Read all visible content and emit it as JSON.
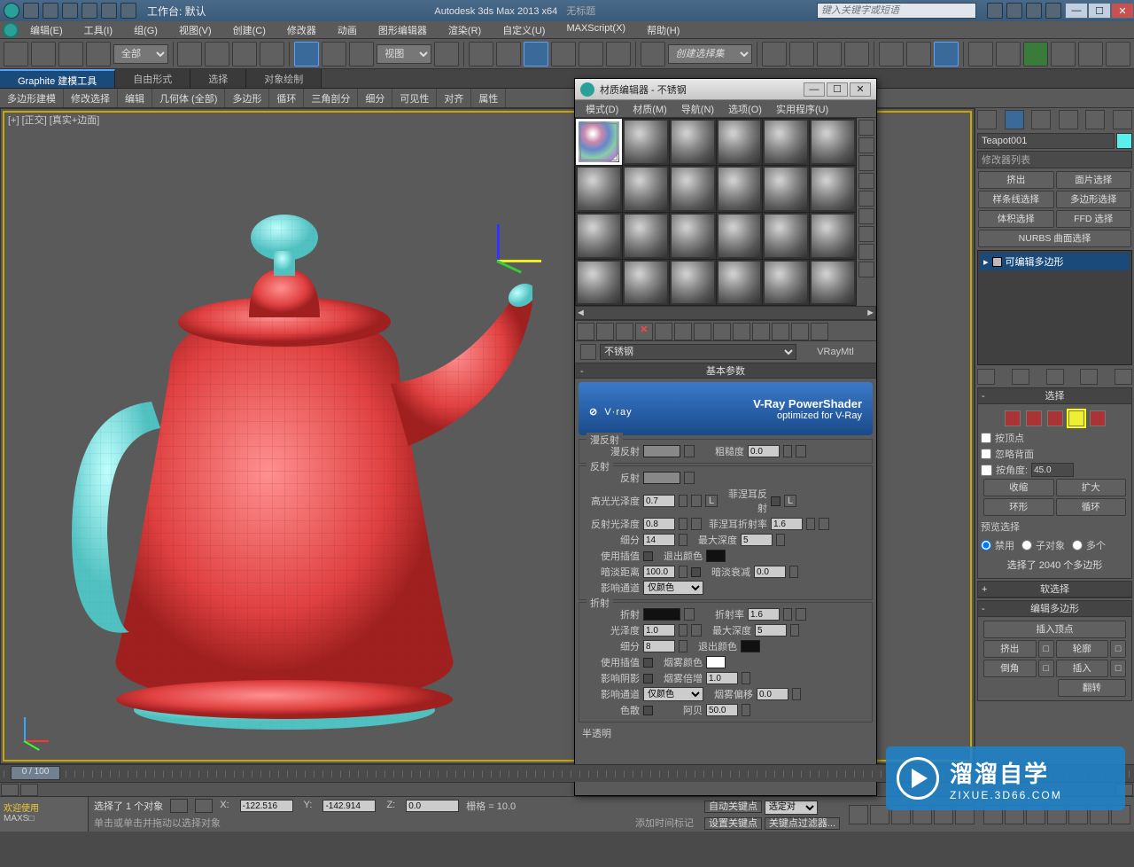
{
  "titlebar": {
    "workspace": "工作台: 默认",
    "app": "Autodesk 3ds Max  2013 x64",
    "untitled": "无标题",
    "search_ph": "键入关键字或短语"
  },
  "menubar": [
    "编辑(E)",
    "工具(I)",
    "组(G)",
    "视图(V)",
    "创建(C)",
    "修改器",
    "动画",
    "图形编辑器",
    "渲染(R)",
    "自定义(U)",
    "MAXScript(X)",
    "帮助(H)"
  ],
  "toolbar": {
    "sel_filter": "全部",
    "refcoord": "视图",
    "named_sel": "创建选择集"
  },
  "ribbon": {
    "tabs": [
      "Graphite 建模工具",
      "自由形式",
      "选择",
      "对象绘制"
    ],
    "bar": [
      "多边形建模",
      "修改选择",
      "编辑",
      "几何体 (全部)",
      "多边形",
      "循环",
      "三角剖分",
      "细分",
      "可见性",
      "对齐",
      "属性"
    ]
  },
  "viewport": {
    "label": "[+] [正交] [真实+边面]"
  },
  "rpanel": {
    "obj": "Teapot001",
    "modlist": "修改器列表",
    "btns1": [
      "挤出",
      "面片选择"
    ],
    "btns2": [
      "样条线选择",
      "多边形选择"
    ],
    "btns3": [
      "体积选择",
      "FFD 选择"
    ],
    "btns4": [
      "NURBS 曲面选择"
    ],
    "stack_item": "可编辑多边形",
    "sel_hd": "选择",
    "byvert": "按顶点",
    "ignback": "忽略背面",
    "byangle": "按角度:",
    "angle": "45.0",
    "shrink": "收缩",
    "grow": "扩大",
    "ring": "环形",
    "loop": "循环",
    "preview": "预览选择",
    "off": "禁用",
    "subobj": "子对象",
    "multi": "多个",
    "sel_info": "选择了 2040 个多边形",
    "soft": "软选择",
    "editpoly": "编辑多边形",
    "insvert": "插入顶点",
    "extrude": "挤出",
    "outline": "轮廓",
    "bevel": "倒角",
    "inset": "插入",
    "flip": "翻转"
  },
  "mat": {
    "title": "材质编辑器 - 不锈钢",
    "menus": [
      "模式(D)",
      "材质(M)",
      "导航(N)",
      "选项(O)",
      "实用程序(U)"
    ],
    "name": "不锈钢",
    "type": "VRayMtl",
    "basic": "基本参数",
    "vray": {
      "brand": "V·ray",
      "line1": "V-Ray PowerShader",
      "line2": "optimized for V-Ray"
    },
    "diffuse": {
      "grp": "漫反射",
      "lbl": "漫反射",
      "rough": "粗糙度",
      "rough_v": "0.0"
    },
    "reflect": {
      "grp": "反射",
      "lbl": "反射",
      "hilight": "高光光泽度",
      "hilight_v": "0.7",
      "rgloss": "反射光泽度",
      "rgloss_v": "0.8",
      "subdiv": "细分",
      "subdiv_v": "14",
      "useinterp": "使用插值",
      "dimdist": "暗淡距离",
      "dimdist_v": "100.0",
      "affect": "影响通道",
      "affect_v": "仅颜色",
      "fresnel": "菲涅耳反射",
      "fior": "菲涅耳折射率",
      "fior_v": "1.6",
      "maxd": "最大深度",
      "maxd_v": "5",
      "exit": "退出颜色",
      "dimfall": "暗淡衰减",
      "dimfall_v": "0.0"
    },
    "refract": {
      "grp": "折射",
      "lbl": "折射",
      "gloss": "光泽度",
      "gloss_v": "1.0",
      "subdiv": "细分",
      "subdiv_v": "8",
      "useinterp": "使用插值",
      "shadow": "影响阴影",
      "affect": "影响通道",
      "affect_v": "仅颜色",
      "dispersion": "色散",
      "ior": "折射率",
      "ior_v": "1.6",
      "maxd": "最大深度",
      "maxd_v": "5",
      "exit": "退出颜色",
      "fogc": "烟雾颜色",
      "fogm": "烟雾倍增",
      "fogm_v": "1.0",
      "fogb": "烟雾偏移",
      "fogb_v": "0.0",
      "abbe": "阿贝",
      "abbe_v": "50.0"
    },
    "translucent": "半透明"
  },
  "timeline": {
    "frame": "0 / 100"
  },
  "status": {
    "welcome": "欢迎使用",
    "maxs": "MAXS□",
    "sel": "选择了 1 个对象",
    "hint": "单击或单击并拖动以选择对象",
    "x": "X:",
    "xv": "-122.516",
    "y": "Y:",
    "yv": "-142.914",
    "z": "Z:",
    "zv": "0.0",
    "grid": "栅格 = 10.0",
    "addtime": "添加时间标记",
    "autokey": "自动关键点",
    "setkey": "设置关键点",
    "keyfilter": "关键点过滤器...",
    "seldd": "选定对"
  },
  "wmark": {
    "big": "溜溜自学",
    "small": "ZIXUE.3D66.COM"
  }
}
